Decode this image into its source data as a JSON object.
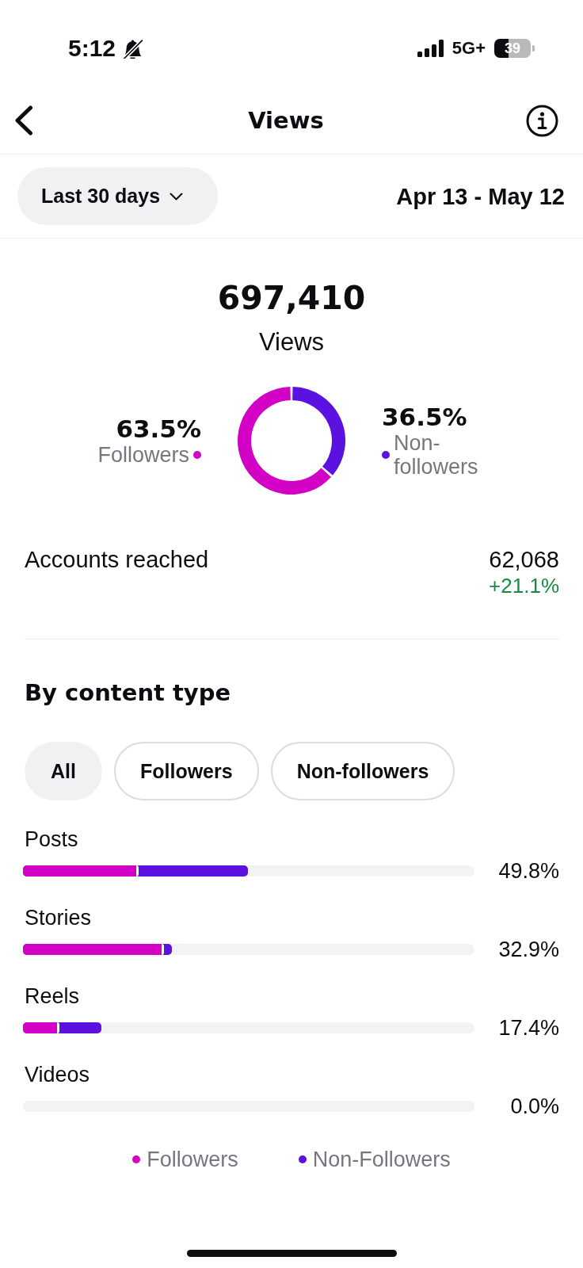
{
  "status_bar": {
    "time": "5:12",
    "network": "5G+",
    "battery": "39"
  },
  "header": {
    "title": "Views"
  },
  "period": {
    "range": "Last 30 days",
    "dates": "Apr 13 - May 12"
  },
  "summary": {
    "total": "697,410",
    "label": "Views"
  },
  "audience": {
    "chart_data": {
      "type": "donut",
      "categories": [
        "Followers",
        "Non-followers"
      ],
      "values": [
        63.5,
        36.5
      ]
    },
    "labels": [
      {
        "value": "63.5%",
        "color": "#d300c5"
      },
      {
        "value": "36.5%",
        "color": "#5b12e0"
      }
    ]
  },
  "accounts_reached": {
    "label": "Accounts reached",
    "value": "62,068",
    "change": "+21.1%"
  },
  "content_type": {
    "title": "By content type",
    "filters": [
      {
        "label": "All",
        "selected": true
      },
      {
        "label": "Followers",
        "selected": false
      },
      {
        "label": "Non-followers",
        "selected": false
      }
    ],
    "rows": [
      {
        "label": "Posts",
        "value": "49.8%",
        "level": 0.498,
        "followers": {
          "level": 0.251
        }
      },
      {
        "label": "Stories",
        "value": "32.9%",
        "level": 0.329,
        "followers": {
          "level": 0.307
        }
      },
      {
        "label": "Reels",
        "value": "17.4%",
        "level": 0.174,
        "followers": {
          "level": 0.075
        }
      },
      {
        "label": "Videos",
        "value": "0.0%"
      }
    ],
    "legend": [
      {
        "label": "Followers",
        "color": "#d300c5"
      },
      {
        "label": "Non-Followers",
        "color": "#5b12e0"
      }
    ]
  }
}
